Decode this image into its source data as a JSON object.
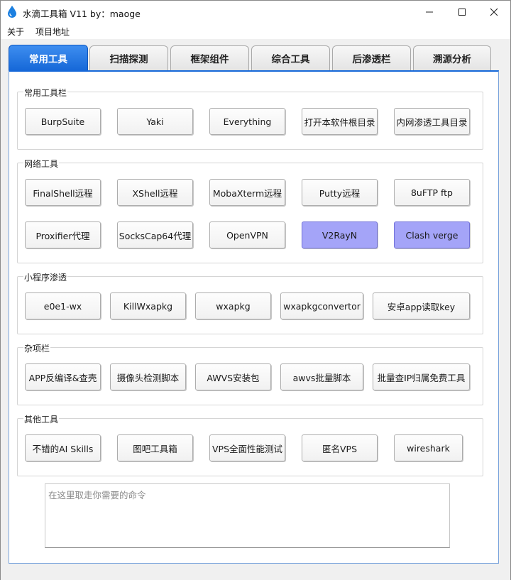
{
  "window": {
    "title": "水滴工具箱 V11 by：maoge",
    "controls": {
      "minimize": "minimize",
      "maximize": "maximize",
      "close": "close"
    }
  },
  "menu": [
    "关于",
    "项目地址"
  ],
  "tabs": [
    "常用工具",
    "扫描探测",
    "框架组件",
    "综合工具",
    "后渗透栏",
    "溯源分析"
  ],
  "active_tab": "常用工具",
  "groups": [
    {
      "title": "常用工具栏",
      "buttons": [
        "BurpSuite",
        "Yaki",
        "Everything",
        "打开本软件根目录",
        "内网渗透工具目录"
      ]
    },
    {
      "title": "网络工具",
      "buttons": [
        "FinalShell远程",
        "XShell远程",
        "MobaXterm远程",
        "Putty远程",
        "8uFTP ftp",
        "Proxifier代理",
        "SocksCap64代理",
        "OpenVPN",
        "V2RayN",
        "Clash verge"
      ]
    },
    {
      "title": "小程序渗透",
      "buttons": [
        "e0e1-wx",
        "KillWxapkg",
        "wxapkg",
        "wxapkgconvertor",
        "安卓app读取key"
      ]
    },
    {
      "title": "杂项栏",
      "buttons": [
        "APP反编译&查壳",
        "摄像头检测脚本",
        "AWVS安装包",
        "awvs批量脚本",
        "批量查IP归属免费工具"
      ]
    },
    {
      "title": "其他工具",
      "buttons": [
        "不错的AI Skills",
        "图吧工具箱",
        "VPS全面性能测试",
        "匿名VPS",
        "wireshark"
      ]
    }
  ],
  "highlight_color": "#a4a4f8",
  "accent_color": "#1668d8",
  "command_box": {
    "placeholder": "在这里取走你需要的命令"
  }
}
